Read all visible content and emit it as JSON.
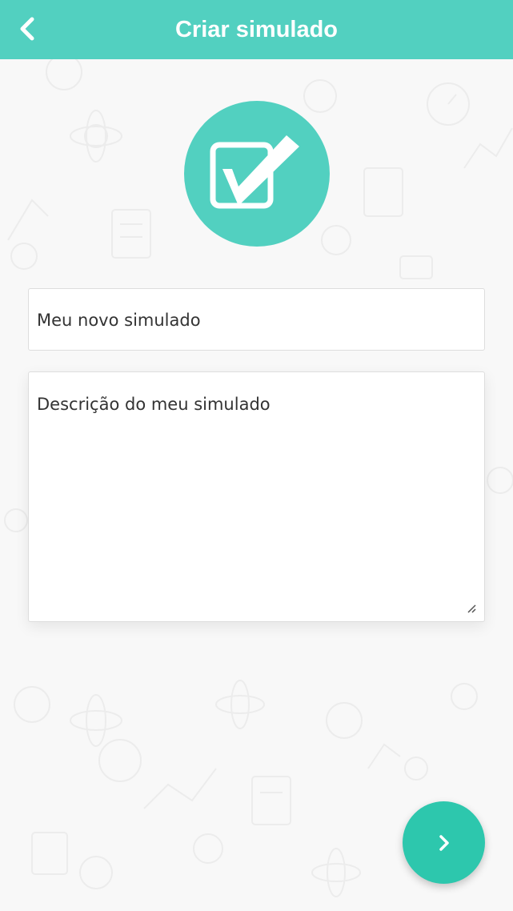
{
  "header": {
    "title": "Criar simulado",
    "back_icon": "chevron-left-icon"
  },
  "logo": {
    "icon": "checkbox-check-icon"
  },
  "form": {
    "title_value": "Meu novo simulado",
    "description_value": "Descrição do meu simulado"
  },
  "next_button": {
    "icon": "chevron-right-icon"
  },
  "colors": {
    "header_bg": "#52d0c0",
    "accent": "#2dc7ad",
    "background": "#f8f8f8"
  }
}
